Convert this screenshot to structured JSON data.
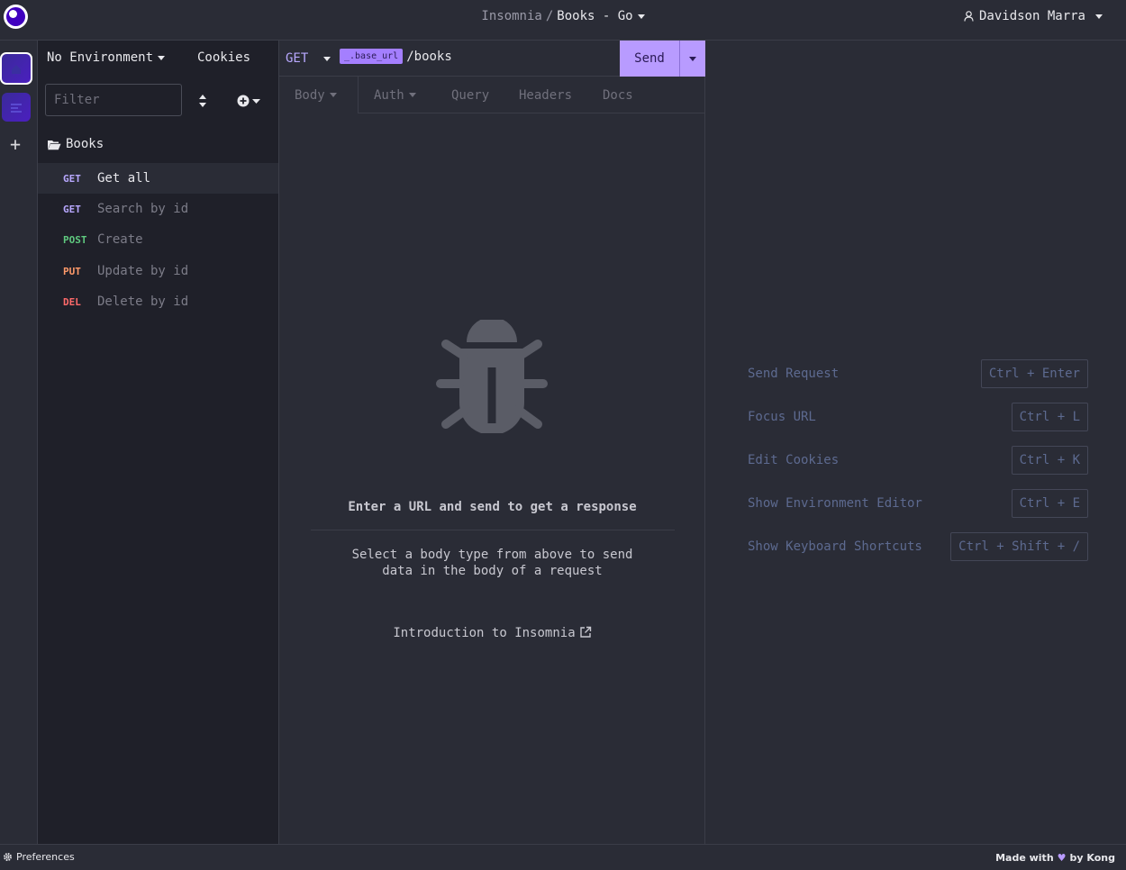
{
  "header": {
    "app_name": "Insomnia",
    "separator": "/",
    "project": "Books - Go",
    "user": "Davidson Marra"
  },
  "rail": {
    "items": [
      {
        "icon": "home-icon",
        "active": true
      },
      {
        "icon": "workspace-icon",
        "active": false
      }
    ],
    "add_icon": "plus-icon"
  },
  "sidebar": {
    "environment": "No Environment",
    "cookies": "Cookies",
    "filter_placeholder": "Filter",
    "folder": "Books",
    "requests": [
      {
        "method": "GET",
        "name": "Get all",
        "color": "#b8a8ff",
        "active": true
      },
      {
        "method": "GET",
        "name": "Search by id",
        "color": "#b8a8ff",
        "active": false
      },
      {
        "method": "POST",
        "name": "Create",
        "color": "#5fc97f",
        "active": false
      },
      {
        "method": "PUT",
        "name": "Update by id",
        "color": "#ff9a6a",
        "active": false
      },
      {
        "method": "DEL",
        "name": "Delete by id",
        "color": "#ff6a6a",
        "active": false
      }
    ]
  },
  "request": {
    "method": "GET",
    "url_variable": "_.base_url",
    "url_path": "/books",
    "send_label": "Send",
    "tabs": {
      "body": "Body",
      "auth": "Auth",
      "query": "Query",
      "headers": "Headers",
      "docs": "Docs"
    },
    "empty_title": "Enter a URL and send to get a response",
    "empty_sub_1": "Select a body type from above to send",
    "empty_sub_2": "data in the body of a request",
    "intro_link": "Introduction to Insomnia"
  },
  "shortcuts": [
    {
      "label": "Send Request",
      "key": "Ctrl + Enter"
    },
    {
      "label": "Focus URL",
      "key": "Ctrl + L"
    },
    {
      "label": "Edit Cookies",
      "key": "Ctrl + K"
    },
    {
      "label": "Show Environment Editor",
      "key": "Ctrl + E"
    },
    {
      "label": "Show Keyboard Shortcuts",
      "key": "Ctrl + Shift + /"
    }
  ],
  "footer": {
    "preferences": "Preferences",
    "made_with": "Made with",
    "by": "by Kong"
  },
  "colors": {
    "accent": "#b89bff",
    "background": "#2a2c36",
    "sidebar": "#1f2029"
  }
}
